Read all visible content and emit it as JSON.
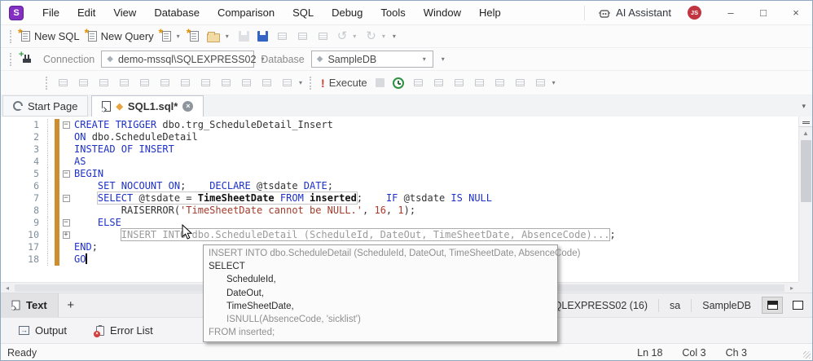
{
  "window": {
    "logo": "S",
    "menus": [
      "File",
      "Edit",
      "View",
      "Database",
      "Comparison",
      "SQL",
      "Debug",
      "Tools",
      "Window",
      "Help"
    ],
    "ai_assistant": "AI Assistant",
    "avatar_initials": "JS",
    "minimize": "–",
    "maximize": "□",
    "close": "×"
  },
  "toolbar_file": {
    "new_sql": "New SQL",
    "new_query": "New Query",
    "icons": [
      {
        "name": "new-document",
        "icon": "doc",
        "caret": true
      },
      {
        "name": "new-file",
        "icon": "doc"
      },
      {
        "name": "open-file",
        "icon": "folder",
        "caret": true
      },
      {
        "name": "save",
        "icon": "floppy",
        "disabled": true
      },
      {
        "name": "save-all",
        "icon": "floppy-blue"
      },
      {
        "name": "cut",
        "icon": "gen",
        "disabled": true
      },
      {
        "name": "copy",
        "icon": "gen",
        "disabled": true
      },
      {
        "name": "paste",
        "icon": "gen",
        "disabled": true
      },
      {
        "name": "undo",
        "glyph": "↺",
        "disabled": true,
        "caret": true
      },
      {
        "name": "redo",
        "glyph": "↻",
        "disabled": true,
        "caret": true
      }
    ]
  },
  "toolbar_connection": {
    "connection_label": "Connection",
    "connection_value": "demo-mssql\\SQLEXPRESS02",
    "database_label": "Database",
    "database_value": "SampleDB"
  },
  "toolbar_editor": {
    "execute_bang": "!",
    "execute_label": "Execute",
    "left_icons": [
      "comment",
      "at-mention",
      "rename",
      "sort-lines",
      "outdent",
      "indent",
      "format-indent",
      "format-lines",
      "bookmark",
      "bookmark-prev",
      "bookmark-next",
      "bookmark-clear"
    ],
    "right_icons": [
      "mail",
      "document-edit",
      "table-add",
      "query-builder",
      "chart",
      "snapshot",
      "export"
    ]
  },
  "tabs": {
    "start_page": "Start Page",
    "sql_tab": "SQL1.sql*"
  },
  "editor": {
    "lines": [
      {
        "n": "1",
        "fold": "m",
        "parts": [
          {
            "segs": [
              {
                "t": "CREATE TRIGGER ",
                "c": "kw"
              },
              {
                "t": "dbo.trg_ScheduleDetail_Insert",
                "c": "id"
              }
            ]
          }
        ]
      },
      {
        "n": "2",
        "fold": "",
        "parts": [
          {
            "segs": [
              {
                "t": "ON ",
                "c": "kw"
              },
              {
                "t": "dbo.ScheduleDetail",
                "c": "id"
              }
            ]
          }
        ]
      },
      {
        "n": "3",
        "fold": "",
        "parts": [
          {
            "segs": [
              {
                "t": "INSTEAD OF INSERT",
                "c": "kw"
              }
            ]
          }
        ]
      },
      {
        "n": "4",
        "fold": "",
        "parts": [
          {
            "segs": [
              {
                "t": "AS",
                "c": "kw"
              }
            ]
          }
        ]
      },
      {
        "n": "5",
        "fold": "m",
        "parts": [
          {
            "segs": [
              {
                "t": "BEGIN",
                "c": "kw"
              }
            ]
          }
        ]
      },
      {
        "n": "6",
        "fold": "",
        "parts": [
          {
            "segs": [
              {
                "t": "    ",
                "c": "id"
              },
              {
                "t": "SET NOCOUNT ON",
                "c": "kw"
              },
              {
                "t": ";    ",
                "c": "id"
              },
              {
                "t": "DECLARE ",
                "c": "kw"
              },
              {
                "t": "@tsdate ",
                "c": "id"
              },
              {
                "t": "DATE",
                "c": "kw"
              },
              {
                "t": ";",
                "c": "id"
              }
            ]
          }
        ]
      },
      {
        "n": "7",
        "fold": "m",
        "parts": [
          {
            "segs": [
              {
                "t": "    ",
                "c": "id"
              }
            ]
          },
          {
            "box": "stmt",
            "segs": [
              {
                "t": "SELECT ",
                "c": "kw"
              },
              {
                "t": "@tsdate = ",
                "c": "id"
              },
              {
                "t": "TimeSheetDate ",
                "c": "b"
              },
              {
                "t": "FROM ",
                "c": "kw"
              },
              {
                "t": "inserted",
                "c": "b"
              }
            ]
          },
          {
            "segs": [
              {
                "t": ";    ",
                "c": "id"
              },
              {
                "t": "IF ",
                "c": "kw"
              },
              {
                "t": "@tsdate ",
                "c": "id"
              },
              {
                "t": "IS NULL",
                "c": "kw"
              }
            ]
          }
        ]
      },
      {
        "n": "8",
        "fold": "",
        "parts": [
          {
            "segs": [
              {
                "t": "        RAISERROR(",
                "c": "id"
              },
              {
                "t": "'TimeSheetDate cannot be NULL.'",
                "c": "str"
              },
              {
                "t": ", ",
                "c": "id"
              },
              {
                "t": "16",
                "c": "num"
              },
              {
                "t": ", ",
                "c": "id"
              },
              {
                "t": "1",
                "c": "num"
              },
              {
                "t": ");",
                "c": "id"
              }
            ]
          }
        ]
      },
      {
        "n": "9",
        "fold": "m",
        "parts": [
          {
            "segs": [
              {
                "t": "    ",
                "c": "id"
              },
              {
                "t": "ELSE",
                "c": "kw"
              }
            ]
          }
        ]
      },
      {
        "n": "10",
        "fold": "p",
        "parts": [
          {
            "segs": [
              {
                "t": "        ",
                "c": "id"
              }
            ]
          },
          {
            "box": "collapsed",
            "segs": [
              {
                "t": "INSERT INTO dbo.ScheduleDetail (ScheduleId, DateOut, TimeSheetDate, AbsenceCode)...",
                "c": "dim"
              }
            ]
          },
          {
            "segs": [
              {
                "t": ";",
                "c": "id"
              }
            ]
          }
        ]
      },
      {
        "n": "17",
        "fold": "",
        "parts": [
          {
            "segs": [
              {
                "t": "END",
                "c": "kw"
              },
              {
                "t": ";",
                "c": "id"
              }
            ]
          }
        ]
      },
      {
        "n": "18",
        "fold": "",
        "caret": true,
        "parts": [
          {
            "segs": [
              {
                "t": "GO",
                "c": "kw"
              }
            ]
          }
        ]
      }
    ]
  },
  "tooltip": {
    "lines": [
      {
        "t": "INSERT INTO dbo.ScheduleDetail (ScheduleId, DateOut, TimeSheetDate, AbsenceCode)",
        "c": "dimt"
      },
      {
        "t": "SELECT",
        "c": "darkt"
      },
      {
        "t": "ScheduleId,",
        "c": "darkt",
        "ind": true
      },
      {
        "t": "DateOut,",
        "c": "darkt",
        "ind": true
      },
      {
        "t": "TimeSheetDate,",
        "c": "darkt",
        "ind": true
      },
      {
        "t": "ISNULL(AbsenceCode, 'sicklist')",
        "c": "dimt",
        "ind": true
      },
      {
        "t": "FROM inserted;",
        "c": "dimt"
      }
    ]
  },
  "results": {
    "text_tab": "Text",
    "add_tab": "+",
    "server": "mssql\\SQLEXPRESS02 (16)",
    "user": "sa",
    "database": "SampleDB"
  },
  "bottom_tabs": {
    "output": "Output",
    "error_list": "Error List"
  },
  "status": {
    "ready": "Ready",
    "ln": "Ln 18",
    "col": "Col 3",
    "ch": "Ch 3"
  },
  "colors": {
    "keyword": "#1e31c9",
    "string": "#a33b2b",
    "change_bar": "#ce8e2f",
    "accent_purple": "#8330c2",
    "avatar_red": "#c13540"
  }
}
